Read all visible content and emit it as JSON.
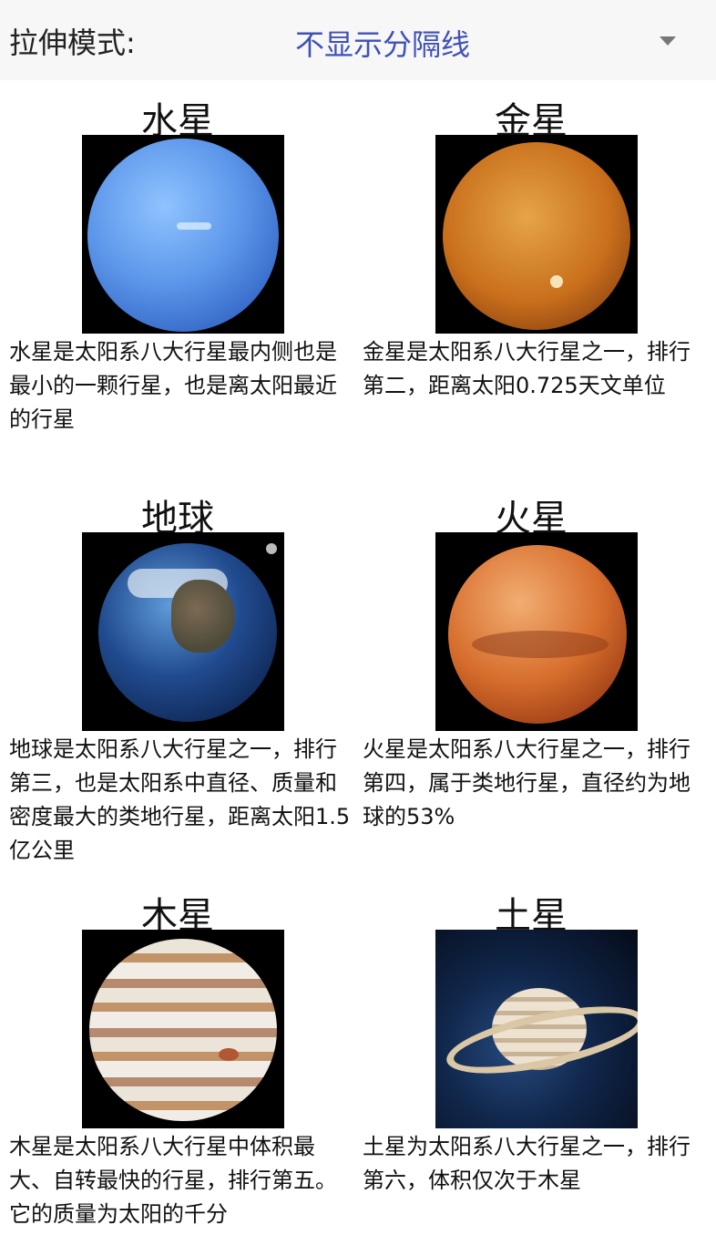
{
  "header": {
    "mode_label": "拉伸模式:",
    "mode_value": "不显示分隔线"
  },
  "cards": [
    {
      "title": "水星",
      "description": "水星是太阳系八大行星最内侧也是最小的一颗行星，也是离太阳最近的行星"
    },
    {
      "title": "金星",
      "description": "金星是太阳系八大行星之一，排行第二，距离太阳0.725天文单位"
    },
    {
      "title": "地球",
      "description": "地球是太阳系八大行星之一，排行第三，也是太阳系中直径、质量和密度最大的类地行星，距离太阳1.5亿公里"
    },
    {
      "title": "火星",
      "description": "火星是太阳系八大行星之一，排行第四，属于类地行星，直径约为地球的53%"
    },
    {
      "title": "木星",
      "description": "木星是太阳系八大行星中体积最大、自转最快的行星，排行第五。它的质量为太阳的千分"
    },
    {
      "title": "土星",
      "description": "土星为太阳系八大行星之一，排行第六，体积仅次于木星"
    }
  ]
}
